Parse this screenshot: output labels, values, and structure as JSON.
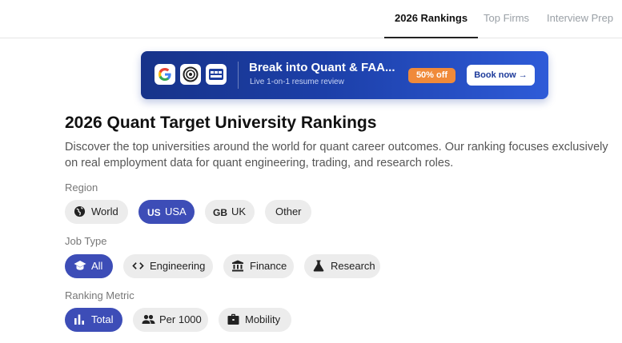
{
  "nav": {
    "tabs": [
      {
        "label": "2026 Rankings",
        "active": true
      },
      {
        "label": "Top Firms",
        "active": false
      },
      {
        "label": "Interview Prep",
        "active": false
      }
    ]
  },
  "banner": {
    "logos": [
      "google-logo-icon",
      "camera-logo-icon",
      "tech-logo-icon"
    ],
    "title": "Break into Quant & FAA...",
    "subtitle": "Live 1-on-1 resume review",
    "discount": "50% off",
    "cta": "Book now →"
  },
  "page": {
    "title": "2026 Quant Target University Rankings",
    "description": "Discover the top universities around the world for quant career outcomes. Our ranking focuses exclusively on real employment data for quant engineering, trading, and research roles."
  },
  "filters": {
    "region": {
      "label": "Region",
      "options": [
        {
          "label": "World",
          "icon": "globe-icon",
          "selected": false
        },
        {
          "label": "USA",
          "code": "US",
          "selected": true
        },
        {
          "label": "UK",
          "code": "GB",
          "selected": false
        },
        {
          "label": "Other",
          "selected": false
        }
      ]
    },
    "job_type": {
      "label": "Job Type",
      "options": [
        {
          "label": "All",
          "icon": "graduation-cap-icon",
          "selected": true
        },
        {
          "label": "Engineering",
          "icon": "code-icon",
          "selected": false
        },
        {
          "label": "Finance",
          "icon": "bank-icon",
          "selected": false
        },
        {
          "label": "Research",
          "icon": "flask-icon",
          "selected": false
        }
      ]
    },
    "ranking_metric": {
      "label": "Ranking Metric",
      "options": [
        {
          "label": "Total",
          "icon": "bar-chart-icon",
          "selected": true
        },
        {
          "label": "Per 1000",
          "icon": "people-icon",
          "selected": false
        },
        {
          "label": "Mobility",
          "icon": "briefcase-icon",
          "selected": false
        }
      ]
    }
  },
  "colors": {
    "accent": "#3d4db7",
    "banner_start": "#17338a",
    "banner_end": "#2e5bd8",
    "discount": "#f08a3a"
  }
}
